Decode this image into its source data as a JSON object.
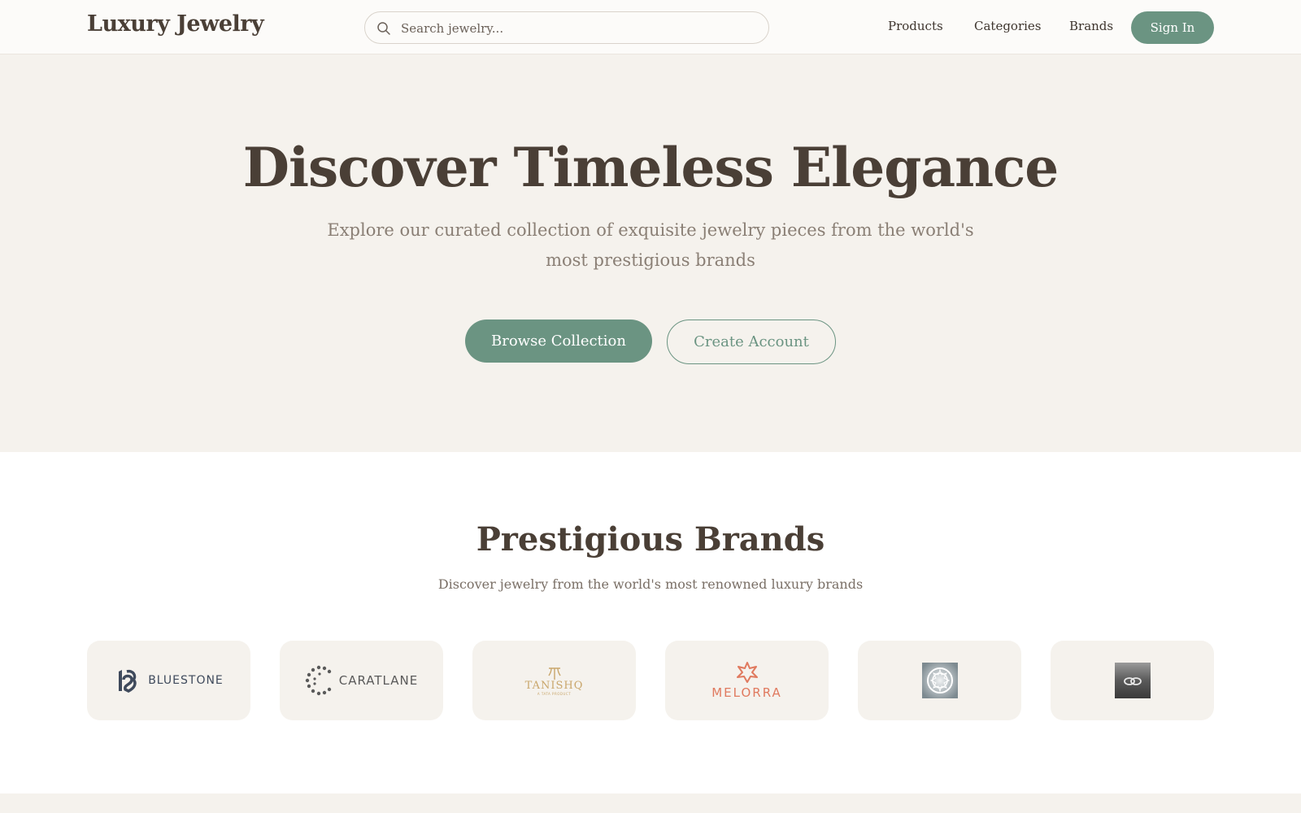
{
  "header": {
    "logo": "Luxury Jewelry",
    "search": {
      "placeholder": "Search jewelry...",
      "value": ""
    },
    "nav": {
      "products": "Products",
      "categories": "Categories",
      "brands": "Brands"
    },
    "sign_in": "Sign In"
  },
  "hero": {
    "title": "Discover Timeless Elegance",
    "subtitle_line1": "Explore our curated collection of exquisite jewelry pieces from the world's",
    "subtitle_line2": "most prestigious brands",
    "browse_button": "Browse Collection",
    "create_account_button": "Create Account"
  },
  "brands_section": {
    "title": "Prestigious Brands",
    "subtitle": "Discover jewelry from the world's most renowned luxury brands",
    "items": [
      {
        "name": "BLUESTONE",
        "icon": "bluestone-logo"
      },
      {
        "name": "CARATLANE",
        "icon": "caratlane-logo"
      },
      {
        "name": "TANISHQ",
        "tagline": "A TATA PRODUCT",
        "icon": "tanishq-logo"
      },
      {
        "name": "MELORRA",
        "icon": "melorra-logo"
      },
      {
        "name": "",
        "icon": "ornate-medallion-logo"
      },
      {
        "name": "",
        "icon": "interlocking-rings-logo"
      }
    ]
  },
  "colors": {
    "accent": "#6b9482",
    "heading": "#4a3f36",
    "muted": "#8a7f75",
    "background": "#f5f2ed",
    "bluestone": "#3f4a5c",
    "caratlane": "#5a5a5a",
    "tanishq": "#c9a66b",
    "melorra": "#e07a5f"
  }
}
